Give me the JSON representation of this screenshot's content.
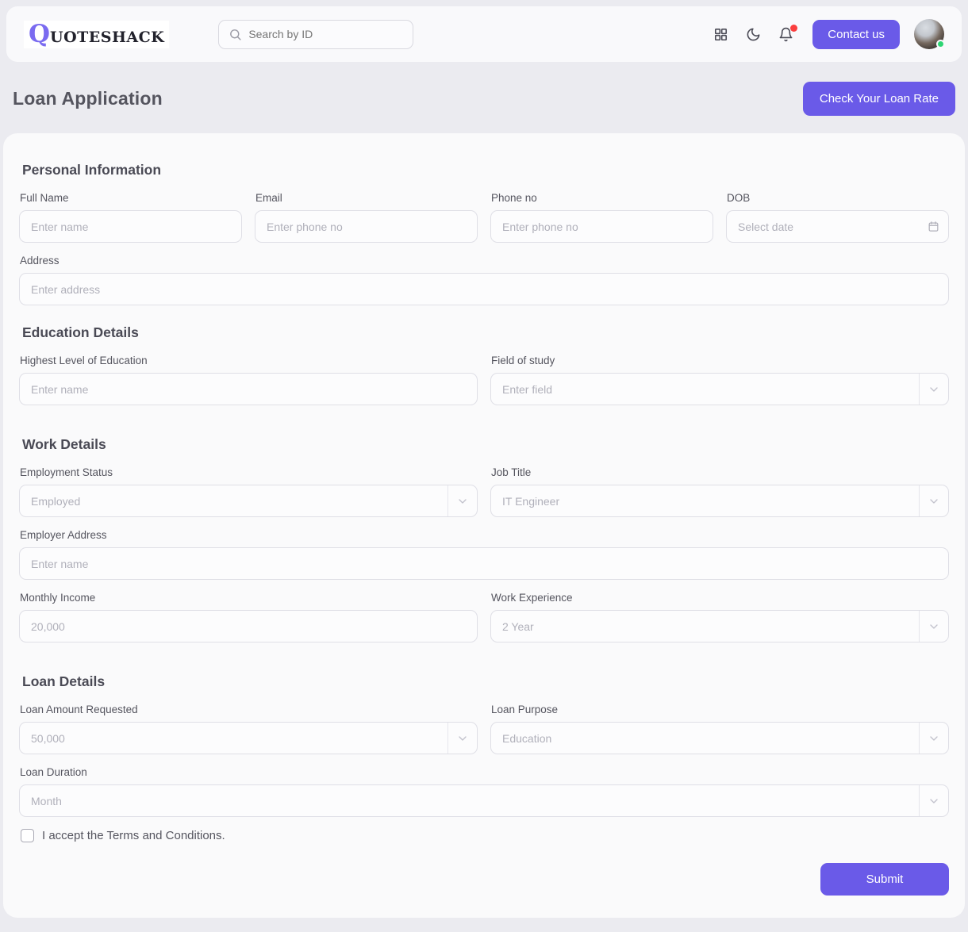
{
  "header": {
    "logo_q": "Q",
    "logo_rest": "UOTESHACK",
    "search_placeholder": "Search by ID",
    "contact_button": "Contact us",
    "icons": [
      "search-icon",
      "grid-icon",
      "moon-icon",
      "bell-icon",
      "avatar"
    ]
  },
  "page": {
    "title": "Loan Application",
    "check_rate_button": "Check Your Loan Rate"
  },
  "form": {
    "sections": [
      {
        "title": "Personal Information",
        "fields": [
          {
            "label": "Full Name",
            "placeholder": "Enter name"
          },
          {
            "label": "Email",
            "placeholder": "Enter phone no"
          },
          {
            "label": "Phone no",
            "placeholder": "Enter phone no"
          },
          {
            "label": "DOB",
            "placeholder": "Select date"
          },
          {
            "label": "Address",
            "placeholder": "Enter address"
          }
        ]
      },
      {
        "title": "Education Details",
        "fields": [
          {
            "label": "Highest Level of Education",
            "placeholder": "Enter name"
          },
          {
            "label": "Field of study",
            "placeholder": "Enter field"
          }
        ]
      },
      {
        "title": "Work Details",
        "fields": [
          {
            "label": "Employment Status",
            "placeholder": "Employed"
          },
          {
            "label": "Job Title",
            "placeholder": "IT Engineer"
          },
          {
            "label": "Employer Address",
            "placeholder": "Enter name"
          },
          {
            "label": "Monthly Income",
            "placeholder": "20,000"
          },
          {
            "label": "Work Experience",
            "placeholder": "2 Year"
          }
        ]
      },
      {
        "title": "Loan Details",
        "fields": [
          {
            "label": "Loan Amount Requested",
            "placeholder": "50,000"
          },
          {
            "label": "Loan Purpose",
            "placeholder": "Education"
          },
          {
            "label": "Loan Duration",
            "placeholder": "Month"
          }
        ]
      }
    ],
    "terms_label": "I accept the Terms and Conditions.",
    "submit_button": "Submit"
  },
  "colors": {
    "accent": "#6a5ae8",
    "notification_dot": "#fa3e3e",
    "online_dot": "#2ed573",
    "page_background": "#ebebf0",
    "card_background": "#fafafb"
  }
}
